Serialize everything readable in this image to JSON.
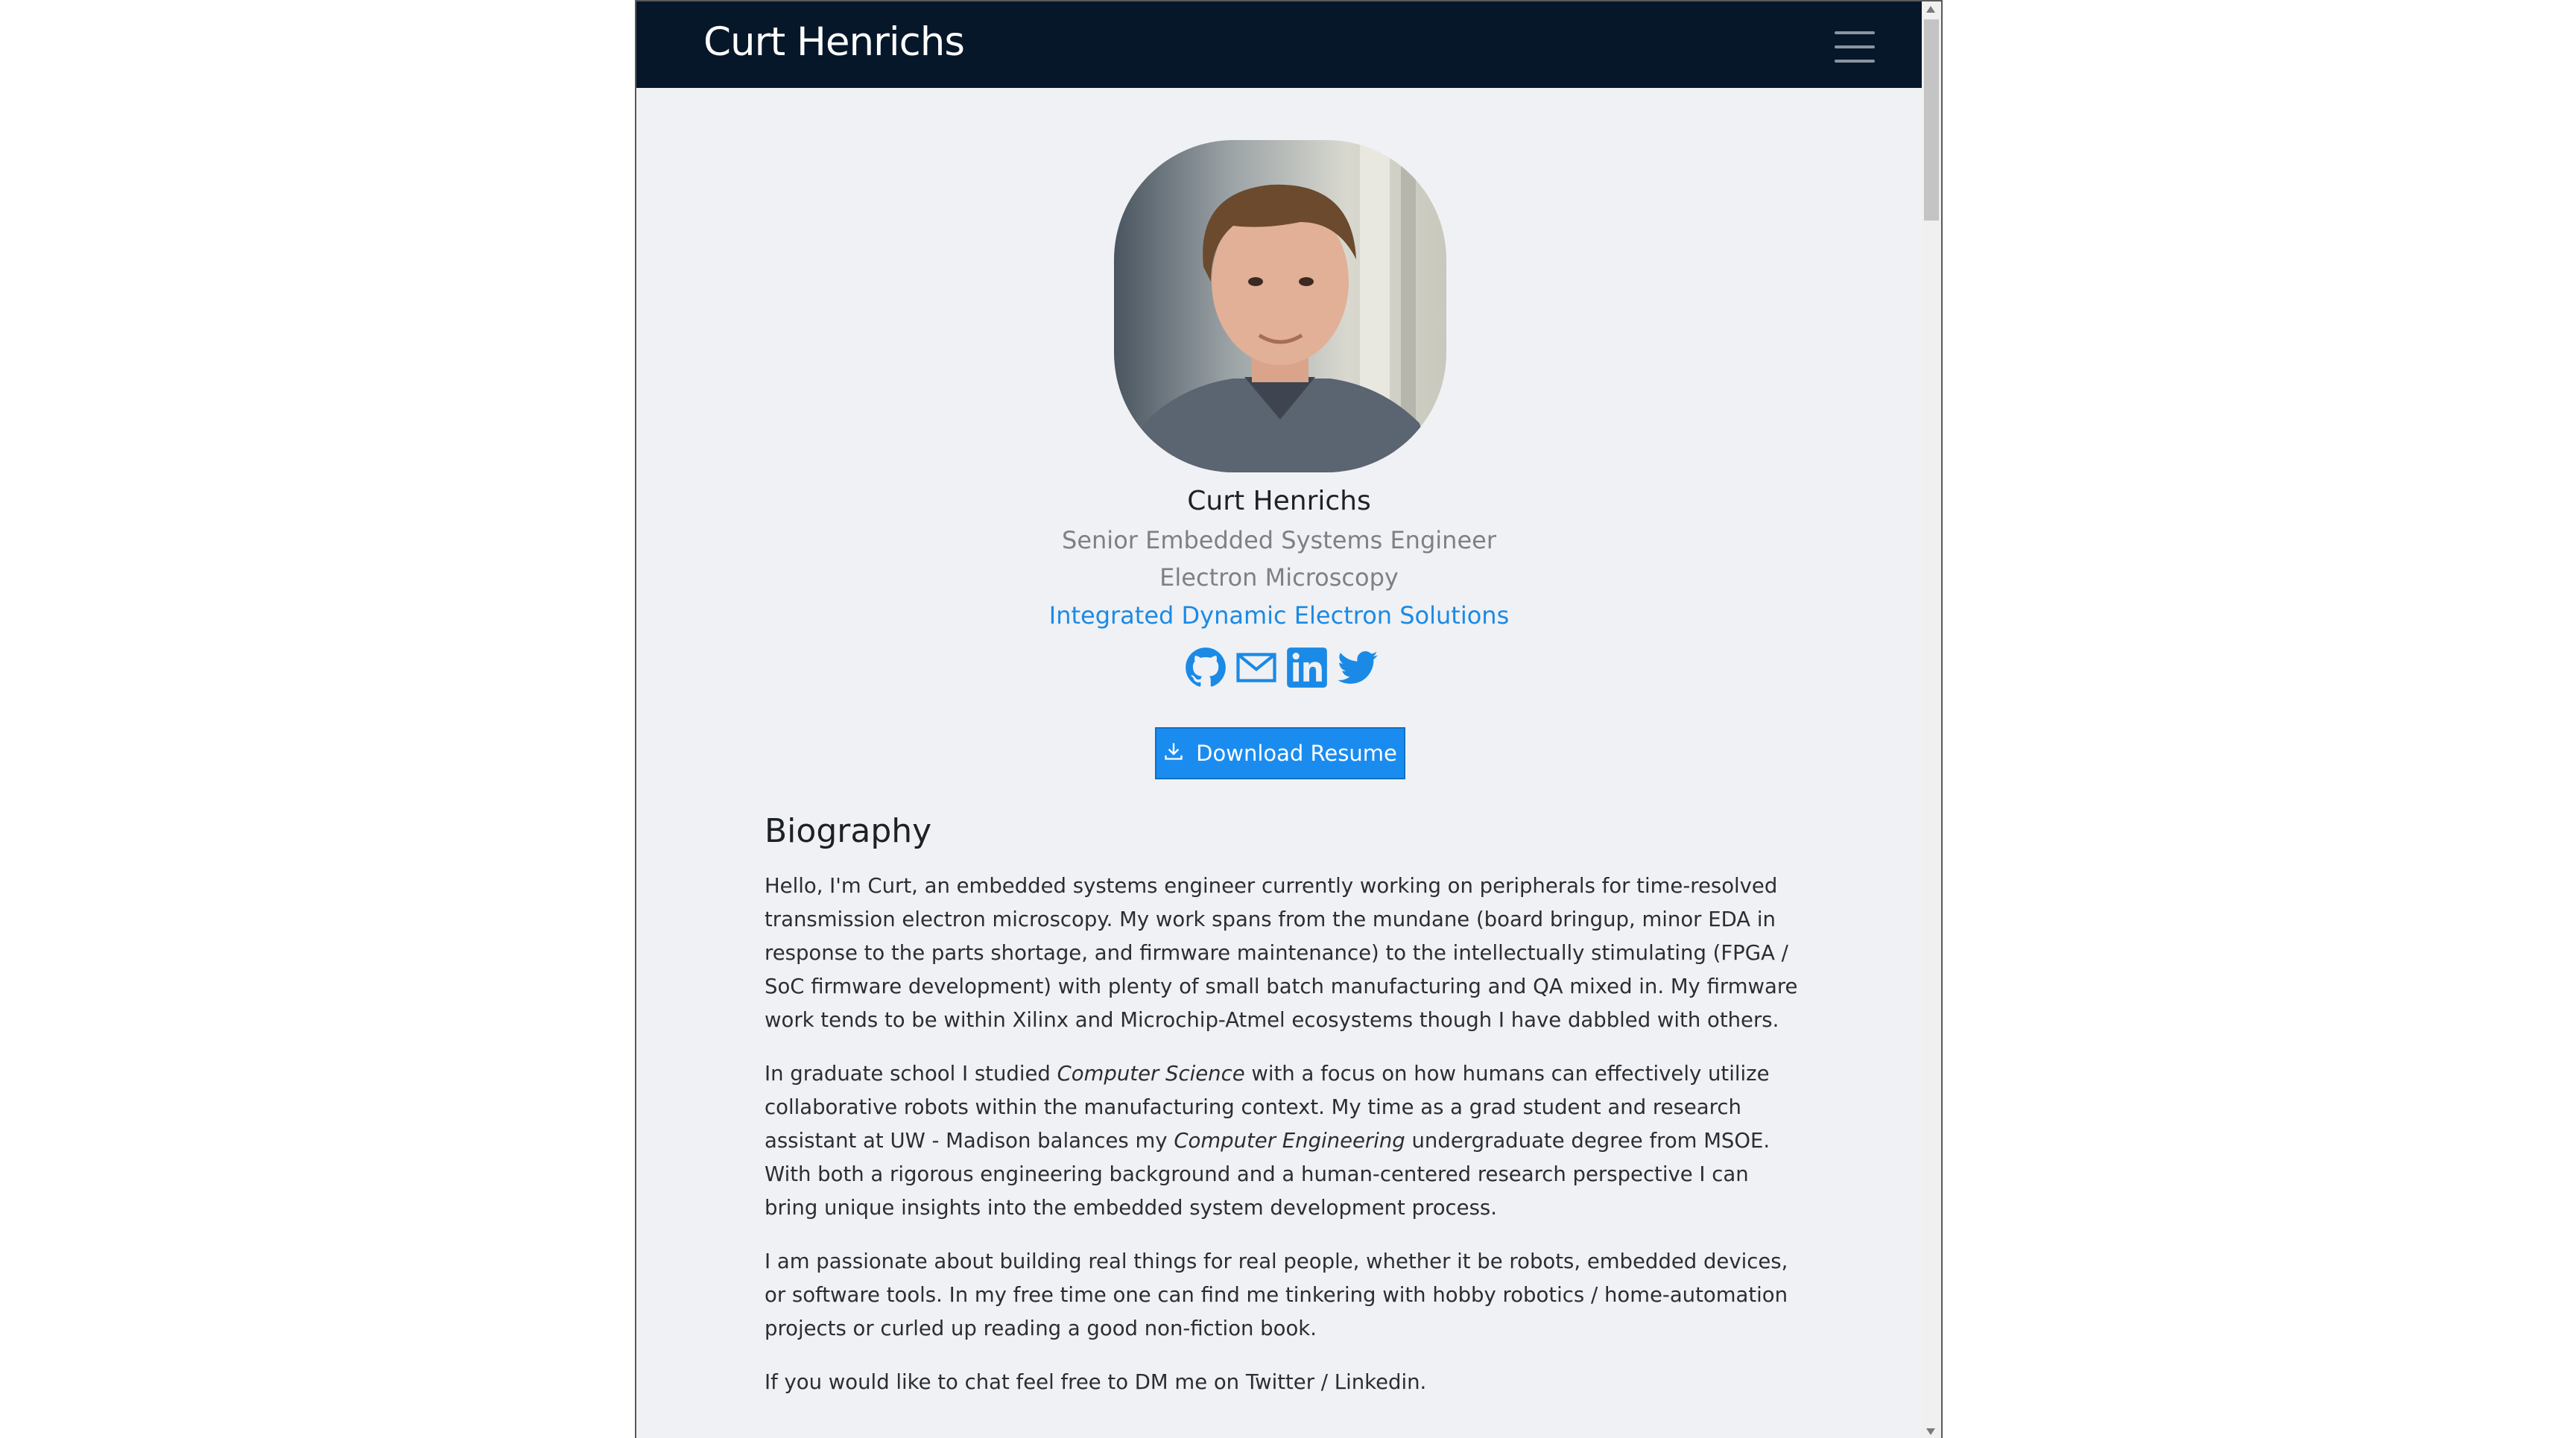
{
  "navbar": {
    "brand": "Curt Henrichs",
    "menu_icon": "hamburger-icon"
  },
  "profile": {
    "name": "Curt Henrichs",
    "title": "Senior Embedded Systems Engineer",
    "field": "Electron Microscopy",
    "company": "Integrated Dynamic Electron Solutions",
    "social_icons": [
      "github-icon",
      "email-icon",
      "linkedin-icon",
      "twitter-icon"
    ]
  },
  "resume_button": {
    "label": "Download Resume",
    "icon": "download-icon"
  },
  "biography": {
    "heading": "Biography",
    "p1": "Hello, I'm Curt, an embedded systems engineer currently working on peripherals for time-resolved transmission electron microscopy. My work spans from the mundane (board bringup, minor EDA in response to the parts shortage, and firmware maintenance) to the intellectually stimulating (FPGA / SoC firmware development) with plenty of small batch manufacturing and QA mixed in. My firmware work tends to be within Xilinx and Microchip-Atmel ecosystems though I have dabbled with others.",
    "p2": {
      "a": "In graduate school I studied ",
      "em1": "Computer Science",
      "b": " with a focus on how humans can effectively utilize collaborative robots within the manufacturing context. My time as a grad student and research assistant at UW - Madison balances my ",
      "em2": "Computer Engineering",
      "c": " undergraduate degree from MSOE. With both a rigorous engineering background and a human-centered research perspective I can bring unique insights into the embedded system development process."
    },
    "p3": "I am passionate about building real things for real people, whether it be robots, embedded devices, or software tools. In my free time one can find me tinkering with hobby robotics / home-automation projects or curled up reading a good non-fiction book.",
    "p4": "If you would like to chat feel free to DM me on Twitter / Linkedin."
  },
  "colors": {
    "navbar": "#07172a",
    "accent": "#1a8ae6",
    "background": "#f0f1f4"
  }
}
